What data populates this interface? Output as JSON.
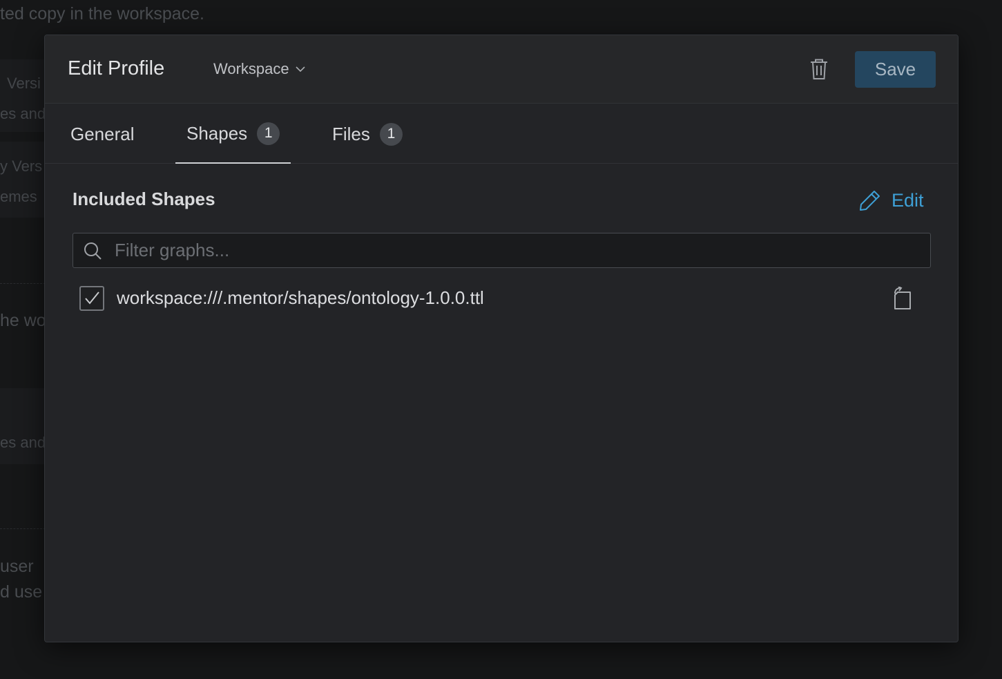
{
  "background": {
    "lines": [
      "ted copy in the workspace.",
      "Versi",
      "es and",
      "y  Vers",
      "emes",
      "he wo",
      "es and",
      " user",
      "d use"
    ]
  },
  "dialog": {
    "title": "Edit Profile",
    "scope_select": "Workspace",
    "save_label": "Save",
    "tabs": [
      {
        "label": "General",
        "count": null
      },
      {
        "label": "Shapes",
        "count": "1"
      },
      {
        "label": "Files",
        "count": "1"
      }
    ],
    "active_tab": "Shapes",
    "section_title": "Included Shapes",
    "edit_label": "Edit",
    "filter_placeholder": "Filter graphs...",
    "graphs": [
      {
        "uri": "workspace:///.mentor/shapes/ontology-1.0.0.ttl",
        "checked": true
      }
    ]
  },
  "colors": {
    "accent": "#3ea0d6",
    "save_button": "#24465f",
    "dialog_bg": "#232427"
  },
  "icons": [
    "chevron-down-icon",
    "trash-icon",
    "pencil-icon",
    "search-icon",
    "checkmark-icon",
    "open-file-icon"
  ]
}
